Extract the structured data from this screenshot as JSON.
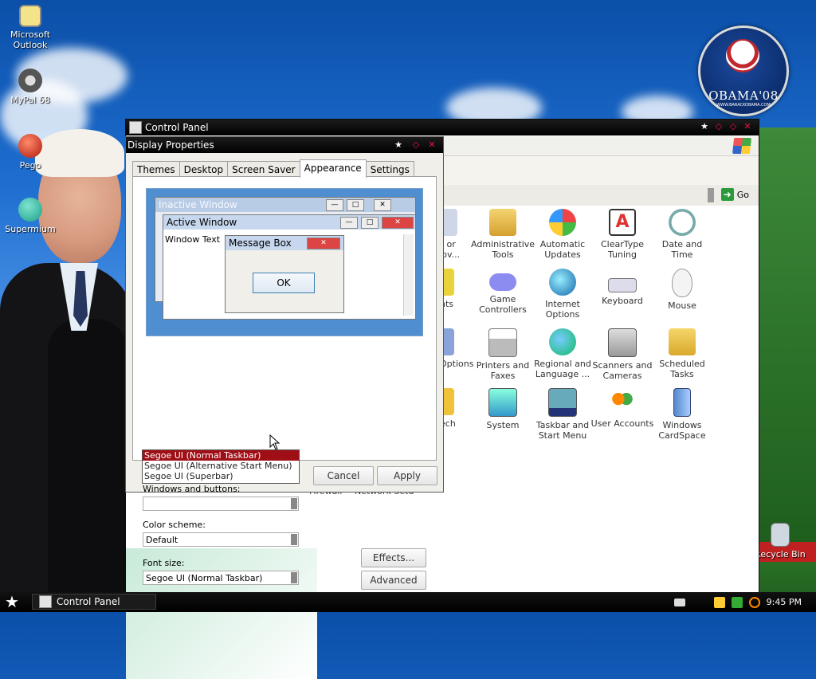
{
  "desktop": {
    "icons": [
      {
        "label": "Microsoft Outlook",
        "icon": "outlook-icon"
      },
      {
        "label": "MyPal 68",
        "icon": "raccoon-icon"
      },
      {
        "label": "Pego",
        "icon": "pego-icon"
      },
      {
        "label": "Supermium",
        "icon": "supermium-icon"
      }
    ],
    "recycle_bin": "Recycle Bin",
    "logo_text": "OBAMA'08",
    "logo_subtext": "WWW.BARACKOBAMA.COM"
  },
  "control_panel": {
    "title": "Control Panel",
    "address_go": "Go",
    "items": [
      {
        "label": "d or rov...",
        "icon": "add-remove-icon"
      },
      {
        "label": "Administrative Tools",
        "icon": "admin-tools-icon"
      },
      {
        "label": "Automatic Updates",
        "icon": "automatic-updates-icon"
      },
      {
        "label": "ClearType Tuning",
        "icon": "cleartype-icon"
      },
      {
        "label": "Date and Time",
        "icon": "date-time-icon"
      },
      {
        "label": "nts",
        "icon": "fonts-icon"
      },
      {
        "label": "Game Controllers",
        "icon": "game-controllers-icon"
      },
      {
        "label": "Internet Options",
        "icon": "internet-options-icon"
      },
      {
        "label": "Keyboard",
        "icon": "keyboard-icon"
      },
      {
        "label": "Mouse",
        "icon": "mouse-icon"
      },
      {
        "label": "Options",
        "icon": "options-icon"
      },
      {
        "label": "Printers and Faxes",
        "icon": "printers-icon"
      },
      {
        "label": "Regional and Language ...",
        "icon": "regional-icon"
      },
      {
        "label": "Scanners and Cameras",
        "icon": "scanners-icon"
      },
      {
        "label": "Scheduled Tasks",
        "icon": "scheduled-tasks-icon"
      },
      {
        "label": "ech",
        "icon": "speech-icon"
      },
      {
        "label": "System",
        "icon": "system-icon"
      },
      {
        "label": "Taskbar and Start Menu",
        "icon": "taskbar-icon"
      },
      {
        "label": "User Accounts",
        "icon": "user-accounts-icon"
      },
      {
        "label": "Windows CardSpace",
        "icon": "cardspace-icon"
      }
    ],
    "partial_bottom": [
      "Firewall",
      "Network Setu"
    ]
  },
  "display_properties": {
    "title": "Display Properties",
    "tabs": [
      "Themes",
      "Desktop",
      "Screen Saver",
      "Appearance",
      "Settings"
    ],
    "selected_tab": "Appearance",
    "preview": {
      "inactive_window": "Inactive Window",
      "active_window": "Active Window",
      "window_text": "Window Text",
      "message_box": "Message Box",
      "ok": "OK"
    },
    "windows_and_buttons_label": "Windows and buttons:",
    "windows_and_buttons_value": "",
    "color_scheme_label": "Color scheme:",
    "color_scheme_value": "Default",
    "font_size_label": "Font size:",
    "font_size_value": "Segoe UI (Normal Taskbar)",
    "font_size_options": [
      "Segoe UI (Normal Taskbar)",
      "Segoe UI (Alternative Start Menu)",
      "Segoe UI (Superbar)"
    ],
    "effects_button": "Effects...",
    "advanced_button": "Advanced",
    "cancel_button": "Cancel",
    "apply_button": "Apply"
  },
  "taskbar": {
    "task_label": "Control Panel",
    "clock": "9:45 PM"
  },
  "colors": {
    "titlebar": "#000000",
    "selection": "#a00e16",
    "close_button": "#e01040"
  }
}
